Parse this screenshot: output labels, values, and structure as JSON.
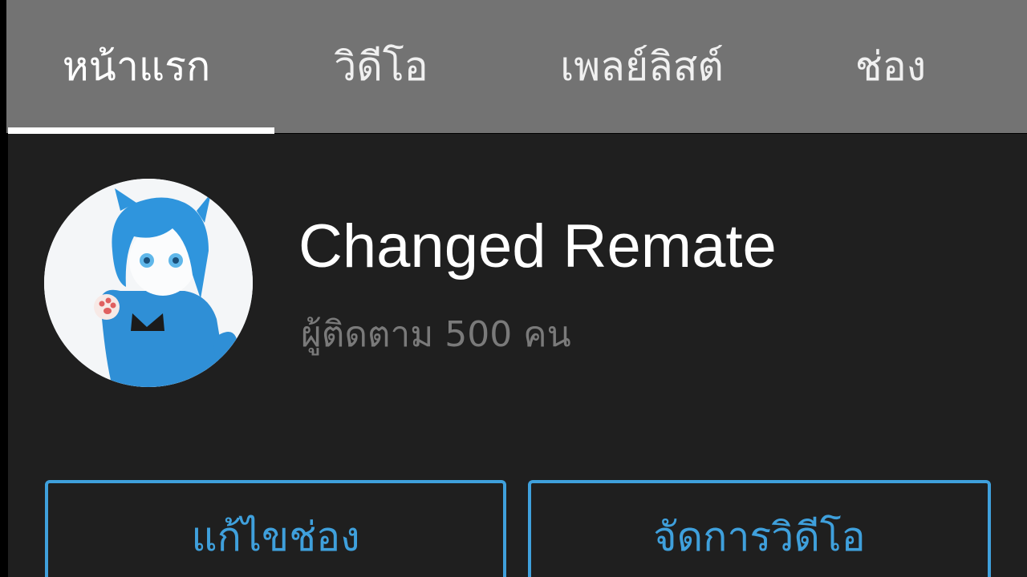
{
  "tabs": [
    {
      "label": "หน้าแรก",
      "active": true
    },
    {
      "label": "วิดีโอ",
      "active": false
    },
    {
      "label": "เพลย์ลิสต์",
      "active": false
    },
    {
      "label": "ช่อง",
      "active": false
    }
  ],
  "channel": {
    "name": "Changed Remate",
    "subscribers": "ผู้ติดตาม 500 คน",
    "avatar_icon": "blue-haired-anime-character-avatar"
  },
  "actions": {
    "edit_channel_label": "แก้ไขช่อง",
    "manage_videos_label": "จัดการวิดีโอ"
  },
  "colors": {
    "tab_bar": "#737373",
    "background": "#1f1f1f",
    "accent": "#3fa0dc",
    "subtitle": "#7a7a7a"
  }
}
